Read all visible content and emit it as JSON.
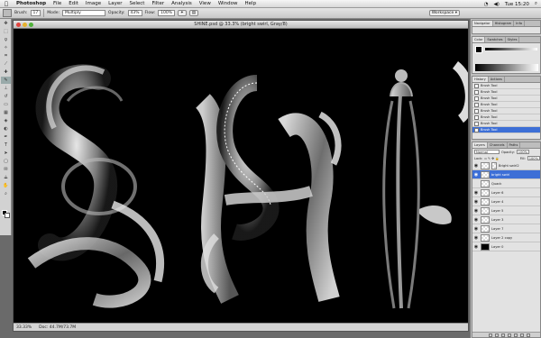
{
  "menubar": {
    "apple": "",
    "items": [
      "Photoshop",
      "File",
      "Edit",
      "Image",
      "Layer",
      "Select",
      "Filter",
      "Analysis",
      "View",
      "Window",
      "Help"
    ],
    "clock": "Tue 15:20"
  },
  "options_bar": {
    "brush_label": "Brush:",
    "brush_size": "17",
    "mode_label": "Mode:",
    "mode_value": "Multiply",
    "opacity_label": "Opacity:",
    "opacity_value": "43%",
    "flow_label": "Flow:",
    "flow_value": "100%",
    "workspace_label": "Workspace ▾"
  },
  "document": {
    "title": "SHINE.psd @ 33.3% (bright swirl, Gray/8)",
    "zoom": "33.33%",
    "doc_size": "Doc: 44.7M/73.7M"
  },
  "nav_panel": {
    "tabs": [
      "Navigator",
      "Histogram",
      "Info"
    ]
  },
  "color_panel": {
    "tabs": [
      "Color",
      "Swatches",
      "Styles"
    ]
  },
  "history_panel": {
    "tabs": [
      "History",
      "Actions"
    ],
    "items": [
      "Brush Tool",
      "Brush Tool",
      "Brush Tool",
      "Brush Tool",
      "Brush Tool",
      "Brush Tool",
      "Brush Tool",
      "Brush Tool"
    ]
  },
  "layers_panel": {
    "tabs": [
      "Layers",
      "Channels",
      "Paths"
    ],
    "blend_mode": "Normal",
    "opacity_label": "Opacity:",
    "opacity_value": "100%",
    "lock_label": "Lock:",
    "fill_label": "Fill:",
    "fill_value": "100%",
    "layers": [
      "Bright swirl2",
      "bright swirl",
      "Quack",
      "Layer 6",
      "Layer 4",
      "Layer 5",
      "Layer 3",
      "Layer 7",
      "Layer 2 copy",
      "Layer 0"
    ]
  }
}
